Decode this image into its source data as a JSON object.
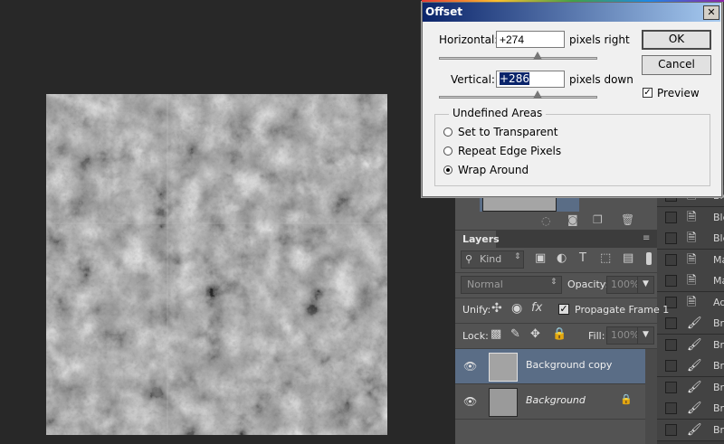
{
  "dialog": {
    "title": "Offset",
    "close_glyph": "✕",
    "horizontal_label": "Horizontal:",
    "horizontal_value": "+274",
    "horizontal_unit": "pixels right",
    "horizontal_slider_level": 0.62,
    "vertical_label": "Vertical:",
    "vertical_value": "+286",
    "vertical_unit": "pixels down",
    "vertical_slider_level": 0.62,
    "ok_label": "OK",
    "cancel_label": "Cancel",
    "preview_label": "Preview",
    "preview_checked": true,
    "undefined_areas_label": "Undefined Areas",
    "options": [
      "Set to Transparent",
      "Repeat Edge Pixels",
      "Wrap Around"
    ],
    "selected_option": "Wrap Around"
  },
  "layers_panel": {
    "tab_label": "Layers",
    "kind_label": "Kind",
    "blend_mode": "Normal",
    "opacity_label": "Opacity:",
    "opacity_value": "100%",
    "unify_label": "Unify:",
    "propagate_label": "Propagate Frame 1",
    "lock_label": "Lock:",
    "fill_label": "Fill:",
    "fill_value": "100%",
    "layers": [
      {
        "name": "Background copy",
        "selected": true
      },
      {
        "name": "Background",
        "selected": false
      }
    ]
  },
  "history_panel": {
    "items": [
      "Ble",
      "Ble",
      "Ble",
      "Ma",
      "Ma",
      "Ad",
      "Br",
      "Br",
      "Br",
      "Br",
      "Br",
      "Br"
    ]
  },
  "colors": {
    "workspace": "#282828",
    "panel": "#535353",
    "selected_layer": "#5a6d86",
    "dialog_bg": "#f0f0f0",
    "title_gradient_start": "#0b246a",
    "title_gradient_end": "#a6caf0"
  }
}
